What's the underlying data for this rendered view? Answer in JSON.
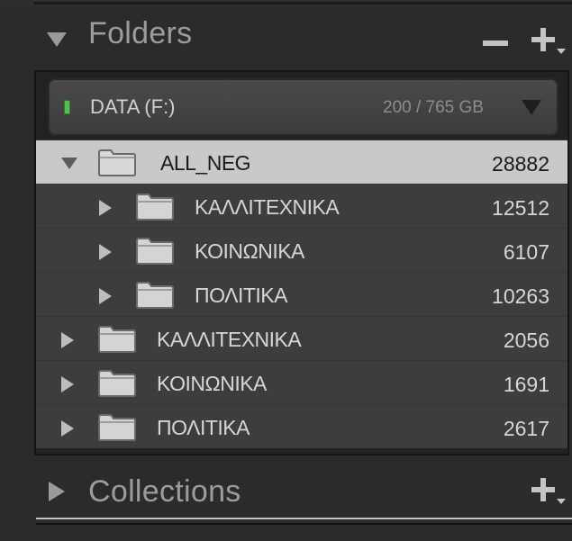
{
  "folders_panel": {
    "title": "Folders",
    "collapse_icon": "triangle-down-icon",
    "remove_icon": "minus-icon",
    "add_icon": "plus-dropdown-icon"
  },
  "volume": {
    "name": "DATA (F:)",
    "size": "200 / 765 GB",
    "status_color": "#52c04c"
  },
  "folders": [
    {
      "name": "ALL_NEG",
      "count": "28882",
      "expanded": true,
      "selected": true,
      "level": 0
    },
    {
      "name": "ΚΑΛΛΙΤΕΧΝΙΚΑ",
      "count": "12512",
      "expanded": false,
      "selected": false,
      "level": 1
    },
    {
      "name": "ΚΟΙΝΩΝΙΚΑ",
      "count": "6107",
      "expanded": false,
      "selected": false,
      "level": 1
    },
    {
      "name": "ΠΟΛΙΤΙΚΑ",
      "count": "10263",
      "expanded": false,
      "selected": false,
      "level": 1
    },
    {
      "name": "ΚΑΛΛΙΤΕΧΝΙΚΑ",
      "count": "2056",
      "expanded": false,
      "selected": false,
      "level": 0
    },
    {
      "name": "ΚΟΙΝΩΝΙΚΑ",
      "count": "1691",
      "expanded": false,
      "selected": false,
      "level": 0
    },
    {
      "name": "ΠΟΛΙΤΙΚΑ",
      "count": "2617",
      "expanded": false,
      "selected": false,
      "level": 0
    }
  ],
  "collections_panel": {
    "title": "Collections",
    "expand_icon": "triangle-right-icon",
    "add_icon": "plus-dropdown-icon"
  }
}
